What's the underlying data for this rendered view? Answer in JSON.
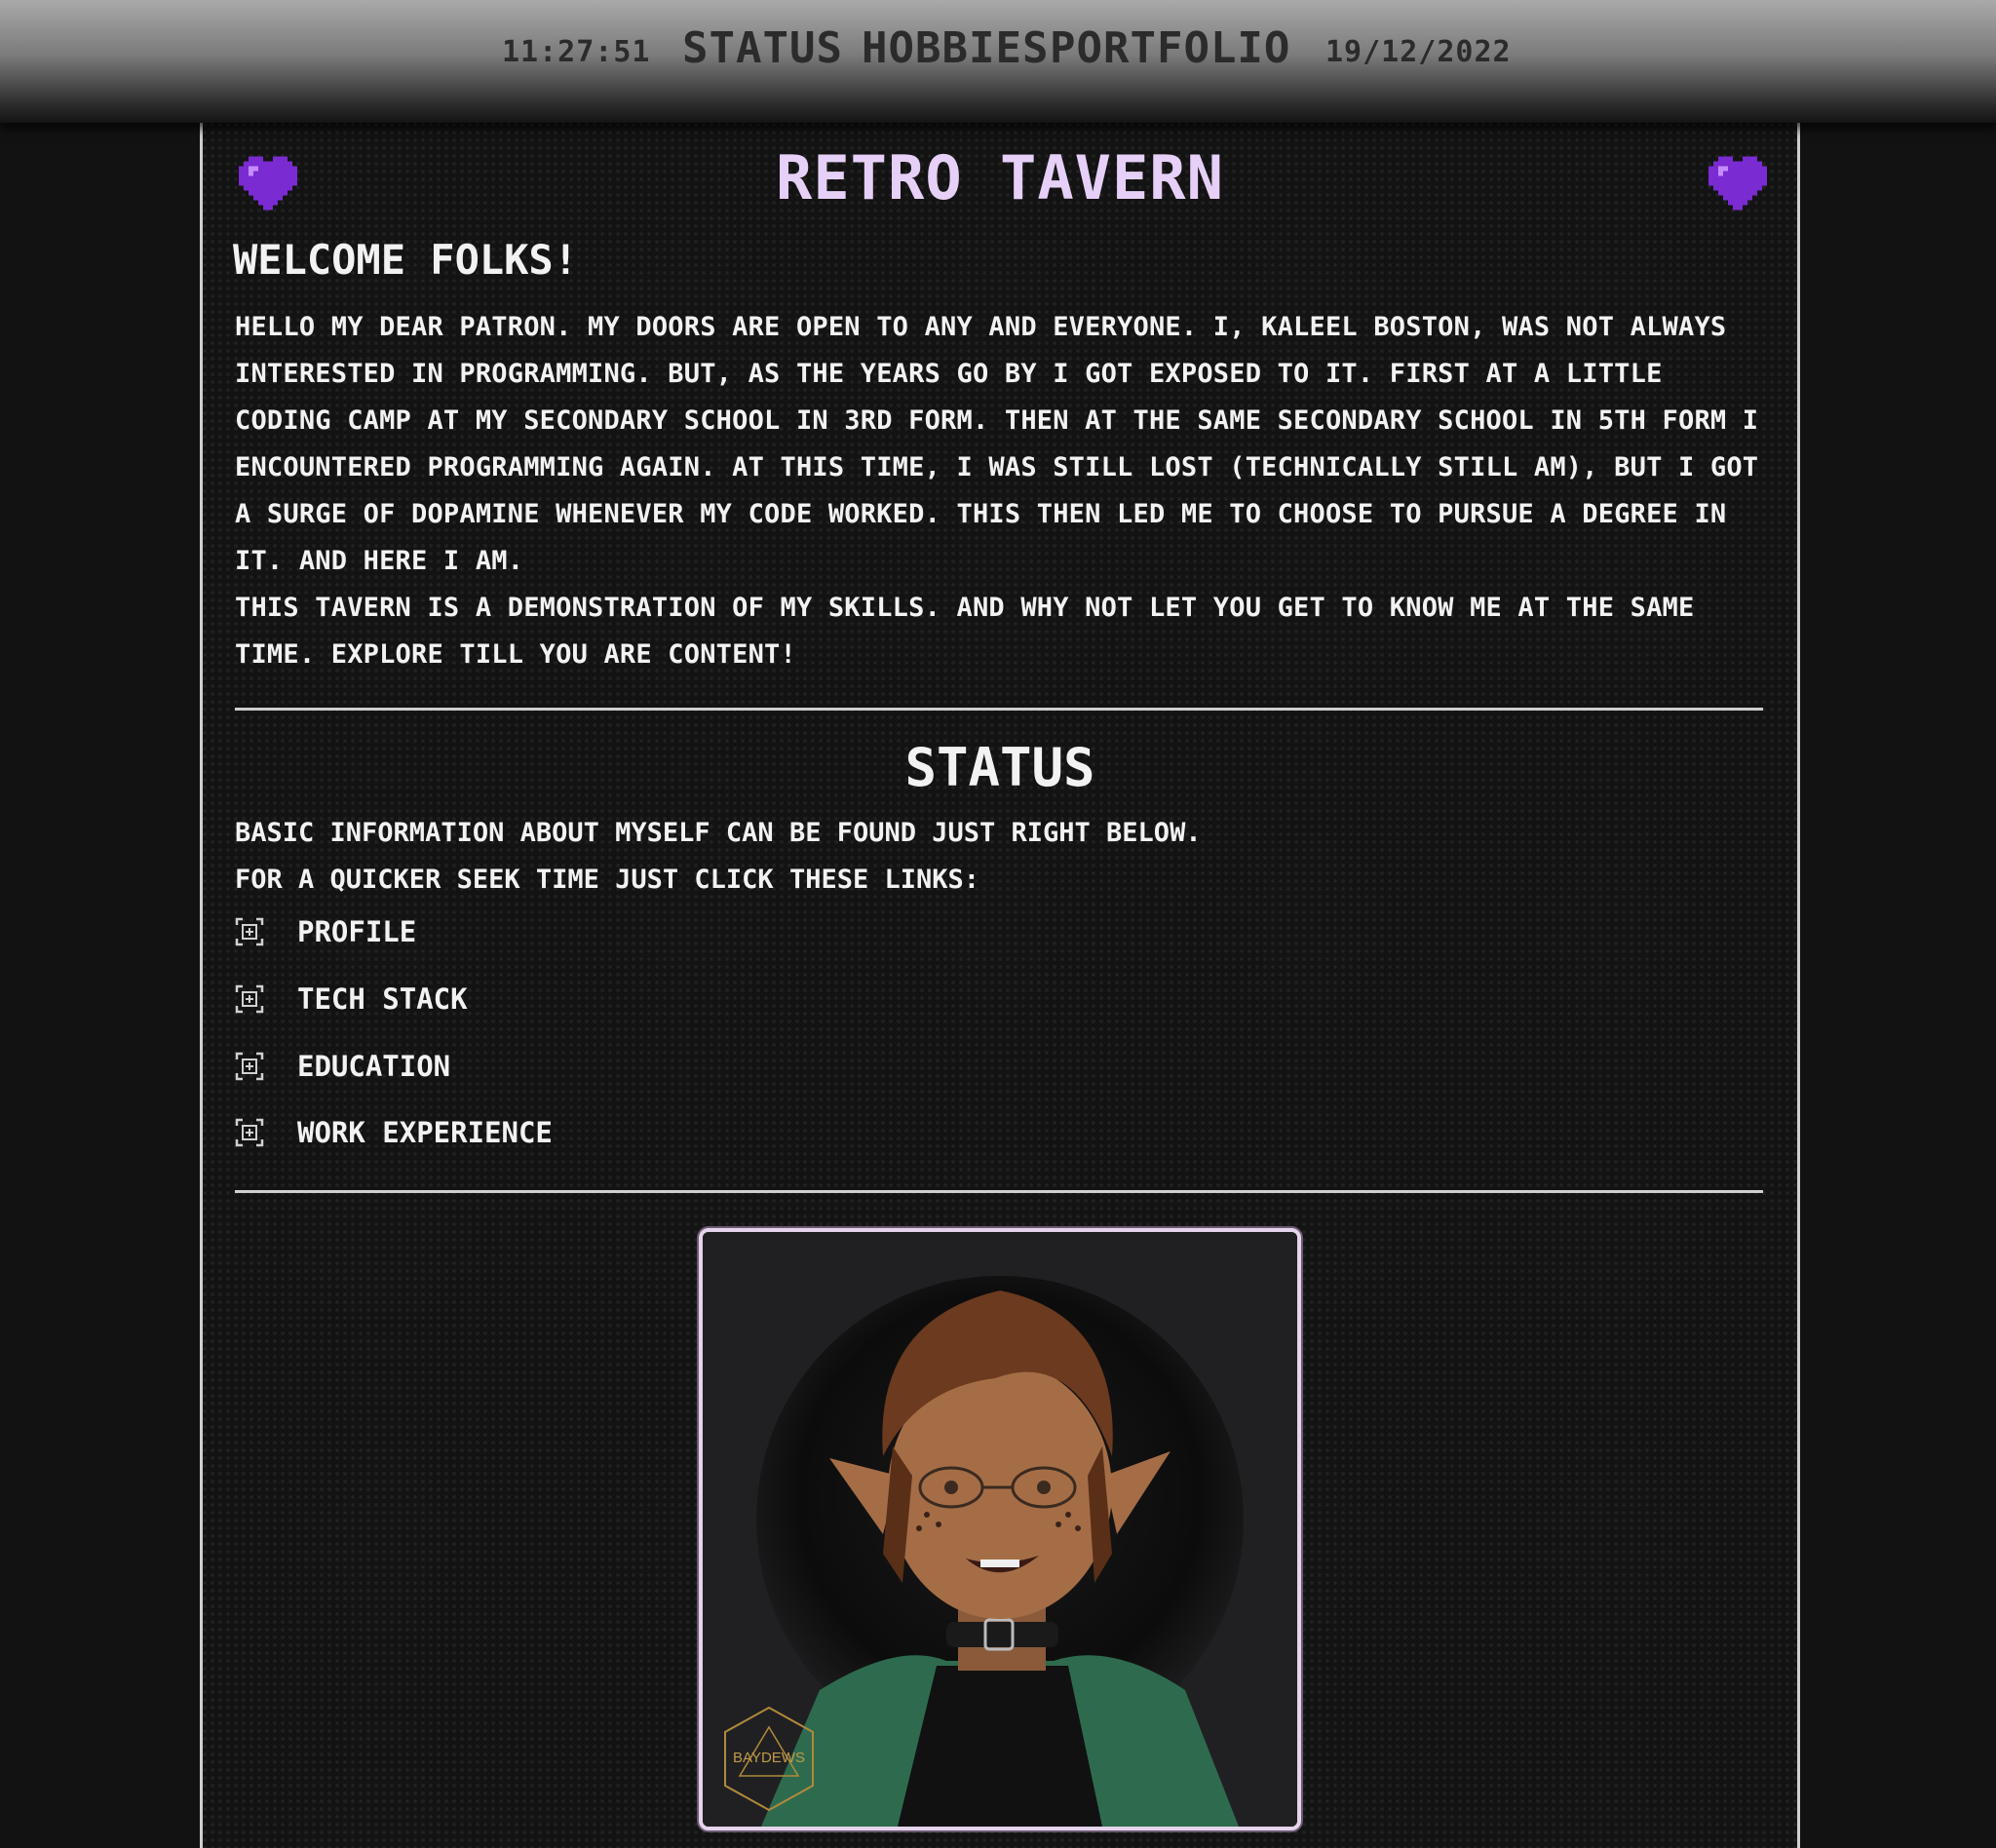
{
  "header": {
    "time": "11:27:51",
    "date": "19/12/2022",
    "nav": [
      "STATUS",
      "HOBBIES",
      "PORTFOLIO"
    ]
  },
  "site": {
    "title": "RETRO TAVERN",
    "heart_color": "#7a2bd1"
  },
  "welcome": {
    "heading": "WELCOME FOLKS!",
    "paragraph1": "Hello my dear patron. My doors are open to any and everyone. I, Kaleel Boston, was not always interested in programming. But, as the years go by I got exposed to it. First at a little coding camp at my secondary school in 3rd form. Then at the same secondary school in 5th form I encountered programming again. At this time, I was still lost (technically still am), but I got a surge of dopamine whenever my code worked. This then led me to choose to pursue a degree in it. And here I am.",
    "paragraph2": "This tavern is a demonstration of my skills. And why not let you get to know me at the same time. Explore till you are content!"
  },
  "status": {
    "heading": "STATUS",
    "line1": "Basic information about myself can be found just right below.",
    "line2": "For a quicker seek time just click these links:",
    "links": [
      "Profile",
      "Tech Stack",
      "Education",
      "Work Experience"
    ]
  },
  "avatar": {
    "watermark": "BAYDEWS"
  }
}
